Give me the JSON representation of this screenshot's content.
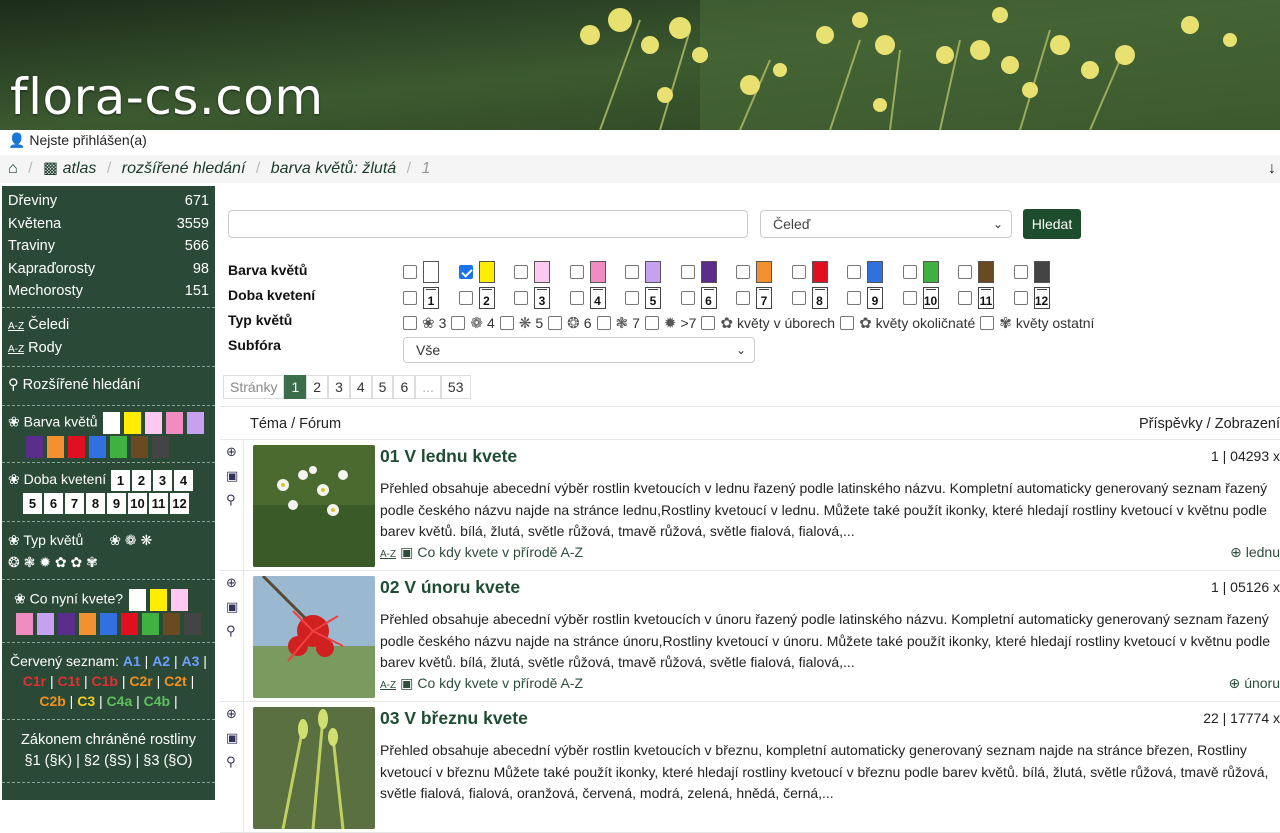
{
  "site": {
    "logo": "flora-cs.com",
    "login_status": "Nejste přihlášen(a)"
  },
  "breadcrumb": {
    "items": [
      "atlas",
      "rozšířené hledání",
      "barva květů: žlutá"
    ],
    "page": "1"
  },
  "sidebar": {
    "categories": [
      {
        "label": "Dřeviny",
        "count": "671"
      },
      {
        "label": "Květena",
        "count": "3559"
      },
      {
        "label": "Traviny",
        "count": "566"
      },
      {
        "label": "Kapraďorosty",
        "count": "98"
      },
      {
        "label": "Mechorosty",
        "count": "151"
      }
    ],
    "links": [
      "Čeledi",
      "Rody"
    ],
    "advanced_search": "Rozšířené hledání",
    "flower_color_label": "Barva květů",
    "flower_colors": [
      "#ffffff",
      "#ffee00",
      "#ffc8f0",
      "#f08cc0",
      "#c8a0f0",
      "#5a2d8a",
      "#f39030",
      "#e01020",
      "#3070e0",
      "#40b040",
      "#6a4a20",
      "#444444"
    ],
    "bloom_time_label": "Doba kvetení",
    "months": [
      "1",
      "2",
      "3",
      "4",
      "5",
      "6",
      "7",
      "8",
      "9",
      "10",
      "11",
      "12"
    ],
    "flower_type_label": "Typ květů",
    "now_blooming_label": "Co nyní kvete?",
    "now_colors": [
      "#ffffff",
      "#ffee00",
      "#ffc8f0",
      "#f08cc0",
      "#c8a0f0",
      "#5a2d8a",
      "#f39030",
      "#3070e0",
      "#e01020",
      "#40b040",
      "#6a4a20",
      "#444444"
    ],
    "red_list_label": "Červený seznam:",
    "red_list": [
      "A1",
      "A2",
      "A3",
      "C1r",
      "C1t",
      "C1b",
      "C2r",
      "C2t",
      "C2b",
      "C3",
      "C4a",
      "C4b"
    ],
    "protected_label": "Zákonem chráněné rostliny",
    "protected": [
      "§1 (§K)",
      "§2 (§S)",
      "§3 (§O)"
    ]
  },
  "filters": {
    "search_placeholder": "",
    "family_select": "Čeleď",
    "search_button": "Hledat",
    "color_label": "Barva květů",
    "colors": [
      "#ffffff",
      "#ffee00",
      "#ffc8f0",
      "#f08cc0",
      "#c8a0f0",
      "#5a2d8a",
      "#f39030",
      "#e01020",
      "#3070e0",
      "#40b040",
      "#6a4a20",
      "#444444"
    ],
    "color_checked_index": 1,
    "bloom_label": "Doba kvetení",
    "months": [
      "1",
      "2",
      "3",
      "4",
      "5",
      "6",
      "7",
      "8",
      "9",
      "10",
      "11",
      "12"
    ],
    "type_label": "Typ květů",
    "types": [
      "3",
      "4",
      "5",
      "6",
      "7",
      ">7",
      "květy v úborech",
      "květy okoličnaté",
      "květy ostatní"
    ],
    "subfora_label": "Subfóra",
    "subfora_value": "Vše"
  },
  "pager": {
    "label": "Stránky",
    "pages": [
      "1",
      "2",
      "3",
      "4",
      "5",
      "6",
      "...",
      "53"
    ],
    "current": "1"
  },
  "table": {
    "col_topic": "Téma / Fórum",
    "col_stats": "Příspěvky / Zobrazení",
    "topics": [
      {
        "title": "01 V lednu kvete",
        "stats": "1 | 04293 x",
        "desc": "Přehled obsahuje abecední výběr rostlin kvetoucích v lednu řazený podle latinského názvu. Kompletní automaticky generovaný seznam řazený podle českého názvu najde na stránce lednu,Rostliny kvetoucí v lednu. Můžete také použít ikonky, které hledají rostliny kvetoucí v květnu podle barev květů. bílá, žlutá, světle růžová, tmavě růžová, světle fialová, fialová,...",
        "footer": "Co kdy kvete v přírodě A-Z",
        "tag": "lednu"
      },
      {
        "title": "02 V únoru kvete",
        "stats": "1 | 05126 x",
        "desc": "Přehled obsahuje abecední výběr rostlin kvetoucích v únoru řazený podle latinského názvu. Kompletní automaticky generovaný seznam řazený podle českého názvu najde na stránce únoru,Rostliny kvetoucí v únoru. Můžete také použít ikonky, které hledají rostliny kvetoucí v květnu podle barev květů. bílá, žlutá, světle růžová, tmavě růžová, světle fialová, fialová,...",
        "footer": "Co kdy kvete v přírodě A-Z",
        "tag": "únoru"
      },
      {
        "title": "03 V březnu kvete",
        "stats": "22 | 17774 x",
        "desc": "Přehled obsahuje abecední výběr rostlin kvetoucích v březnu, kompletní automaticky generovaný seznam najde na stránce březen, Rostliny kvetoucí v březnu Můžete také použít ikonky, které hledají rostliny kvetoucí v březnu podle barev květů. bílá, žlutá, světle růžová, tmavě růžová, světle fialová, fialová, oranžová, červená, modrá, zelená, hnědá, černá,...",
        "footer": "",
        "tag": ""
      }
    ]
  }
}
